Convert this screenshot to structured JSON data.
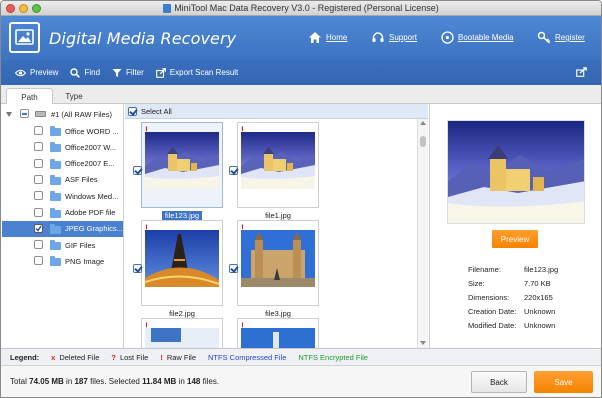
{
  "window": {
    "title": "MiniTool Mac Data Recovery V3.0 - Registered (Personal License)"
  },
  "header": {
    "app_title": "Digital Media Recovery",
    "nav": {
      "home": "Home",
      "support": "Support",
      "bootable": "Bootable Media",
      "register": "Register"
    }
  },
  "toolbar": {
    "preview": "Preview",
    "find": "Find",
    "filter": "Filter",
    "export": "Export Scan Result"
  },
  "tabs": {
    "path": "Path",
    "type": "Type"
  },
  "tree": {
    "root": "#1 (All RAW Files)",
    "items": [
      {
        "label": "Office WORD ..."
      },
      {
        "label": "Office2007 W..."
      },
      {
        "label": "Office2007 E..."
      },
      {
        "label": "ASF Files"
      },
      {
        "label": "Windows Med..."
      },
      {
        "label": "Adobe PDF file"
      },
      {
        "label": "JPEG Graphics..."
      },
      {
        "label": "GIF Files"
      },
      {
        "label": "PNG Image"
      }
    ],
    "selected_index": 6
  },
  "grid": {
    "select_all": "Select All",
    "files": [
      {
        "name": "file123.jpg"
      },
      {
        "name": "file1.jpg"
      },
      {
        "name": "file2.jpg"
      },
      {
        "name": "file3.jpg"
      },
      {
        "name": ""
      },
      {
        "name": ""
      }
    ],
    "lost_marker": "!"
  },
  "preview": {
    "button": "Preview",
    "info": {
      "filename_label": "Filename:",
      "filename": "file123.jpg",
      "size_label": "Size:",
      "size": "7.70 KB",
      "dimensions_label": "Dimensions:",
      "dimensions": "220x165",
      "creation_label": "Creation Date:",
      "creation": "Unknown",
      "modified_label": "Modified Date:",
      "modified": "Unknown"
    }
  },
  "legend": {
    "title": "Legend:",
    "deleted_mark": "x",
    "deleted": "Deleted File",
    "lost_mark": "?",
    "lost": "Lost File",
    "raw_mark": "!",
    "raw": "Raw File",
    "compressed": "NTFS Compressed File",
    "encrypted": "NTFS Encrypted File"
  },
  "status": {
    "p1": "Total ",
    "total_size": "74.05 MB",
    "p2": " in ",
    "total_files": "187",
    "p3": " files.  Selected ",
    "sel_size": "11.84 MB",
    "p4": " in ",
    "sel_files": "148",
    "p5": " files."
  },
  "buttons": {
    "back": "Back",
    "save": "Save"
  },
  "colors": {
    "header_blue": "#4a82d0",
    "toolbar_blue": "#3769b6",
    "accent_orange": "#f58300",
    "selection_blue": "#4b82cf",
    "deleted_red": "#d61f1f",
    "compressed_blue": "#2b45c8",
    "encrypted_green": "#1f9a2e"
  }
}
